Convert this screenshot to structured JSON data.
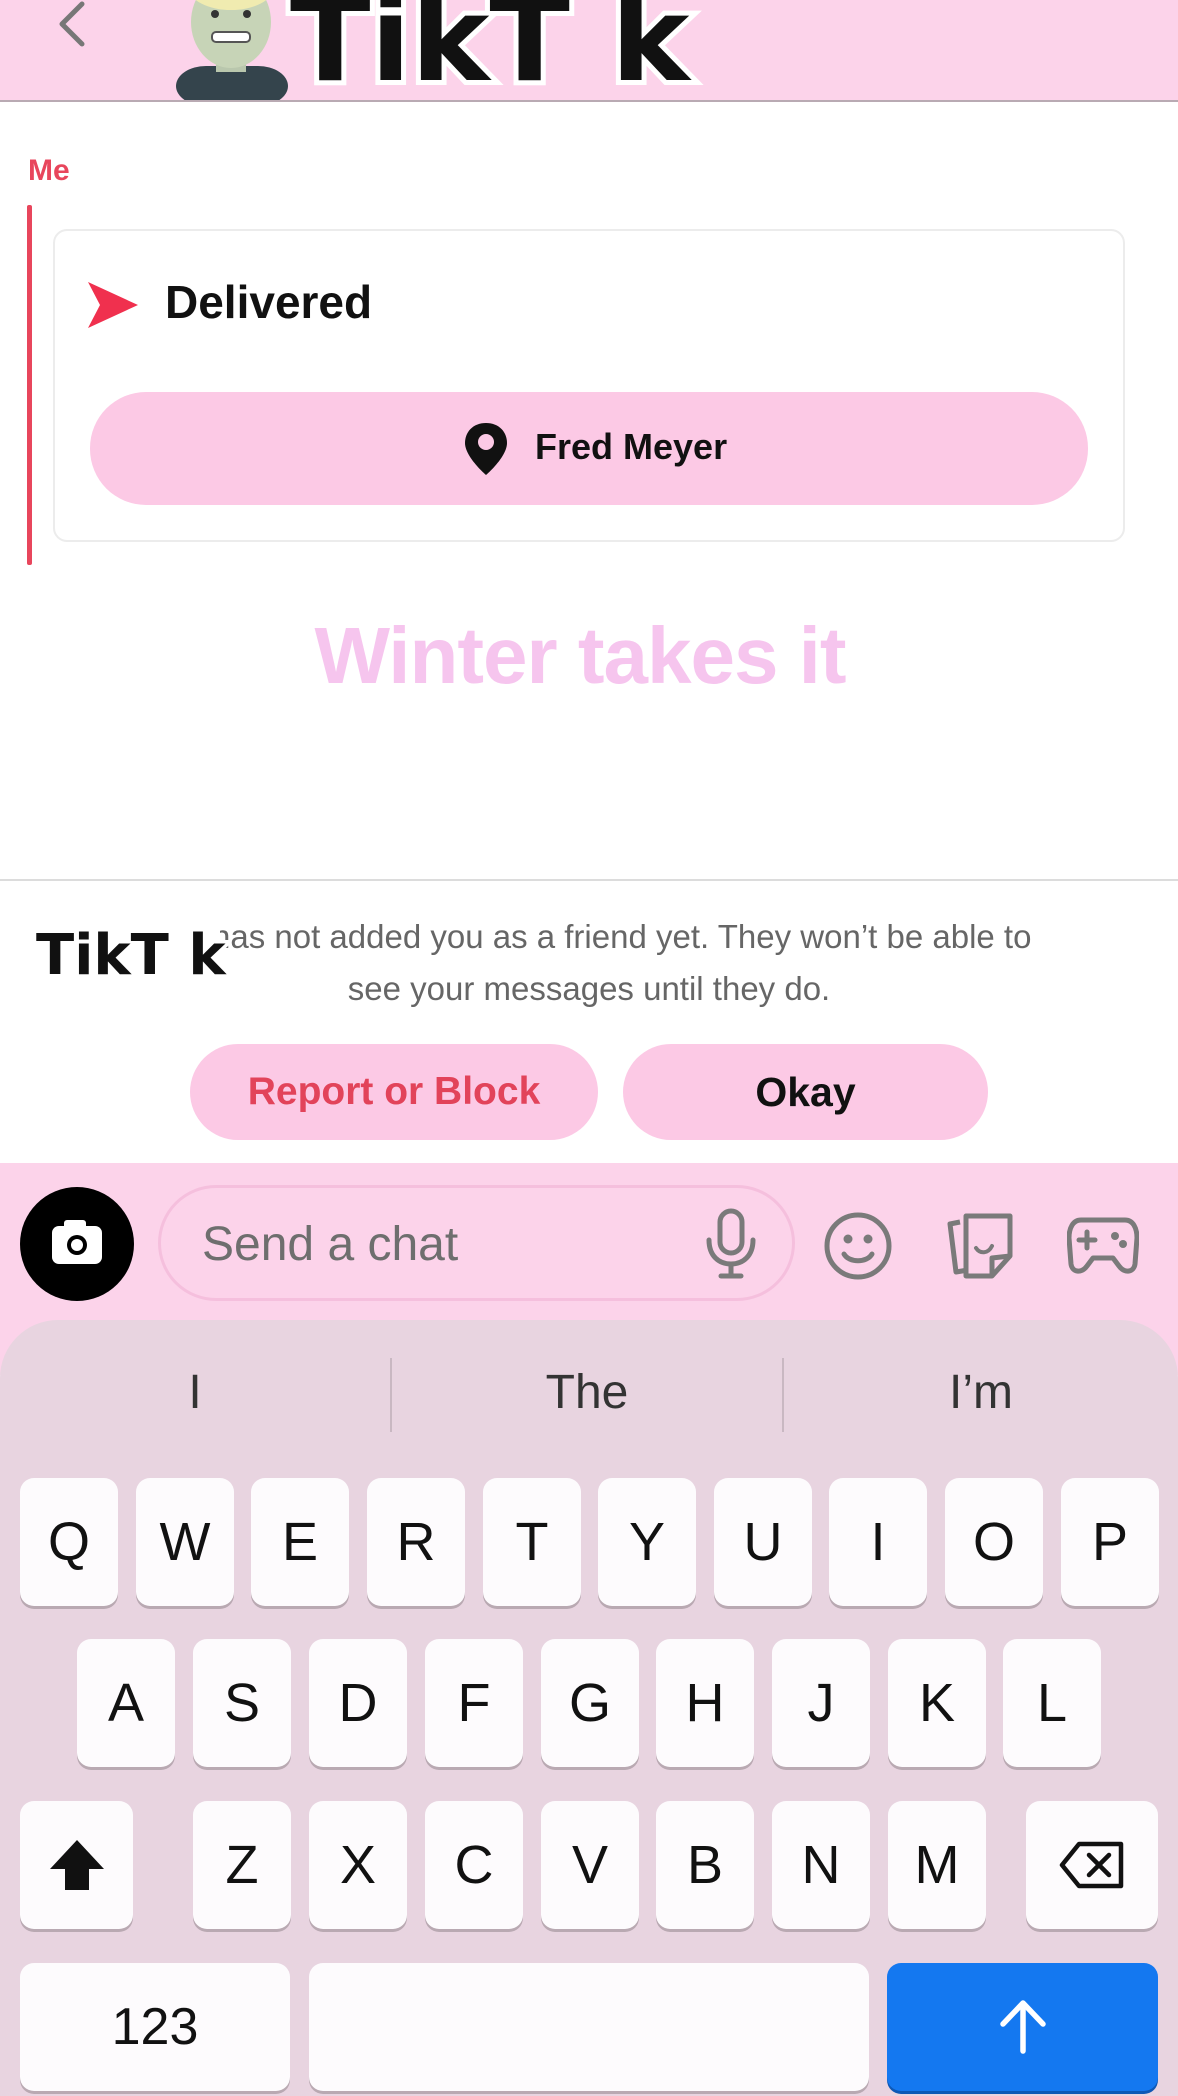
{
  "header": {
    "back_icon": "chevron-left-icon",
    "avatar_icon": "bitmoji-avatar",
    "logo_text": "TikT k"
  },
  "message": {
    "sender": "Me",
    "status": "Delivered",
    "status_icon": "delivered-arrow-icon",
    "location_icon": "map-pin-icon",
    "location": "Fred Meyer",
    "overlay_text": "Winter takes it"
  },
  "notice": {
    "sticker_text": "TikT k",
    "line1": "has not added you as a friend yet. They won’t be able to",
    "line2": "see your messages until they do.",
    "report_button": "Report or Block",
    "okay_button": "Okay"
  },
  "chatbar": {
    "camera_icon": "camera-icon",
    "placeholder": "Send a chat",
    "mic_icon": "microphone-icon",
    "emoji_icon": "emoji-icon",
    "sticker_icon": "sticker-icon",
    "game_icon": "gamepad-icon"
  },
  "keyboard": {
    "suggestions": [
      "I",
      "The",
      "I’m"
    ],
    "row1": [
      "Q",
      "W",
      "E",
      "R",
      "T",
      "Y",
      "U",
      "I",
      "O",
      "P"
    ],
    "row2": [
      "A",
      "S",
      "D",
      "F",
      "G",
      "H",
      "J",
      "K",
      "L"
    ],
    "row3": [
      "Z",
      "X",
      "C",
      "V",
      "B",
      "N",
      "M"
    ],
    "numbers_key": "123",
    "shift_icon": "shift-icon",
    "backspace_icon": "backspace-icon",
    "return_icon": "send-arrow-icon"
  },
  "colors": {
    "accent_pink": "#fcc9e5",
    "header_pink": "#fcd3ea",
    "red": "#e8465c",
    "return_blue": "#1478f0"
  }
}
